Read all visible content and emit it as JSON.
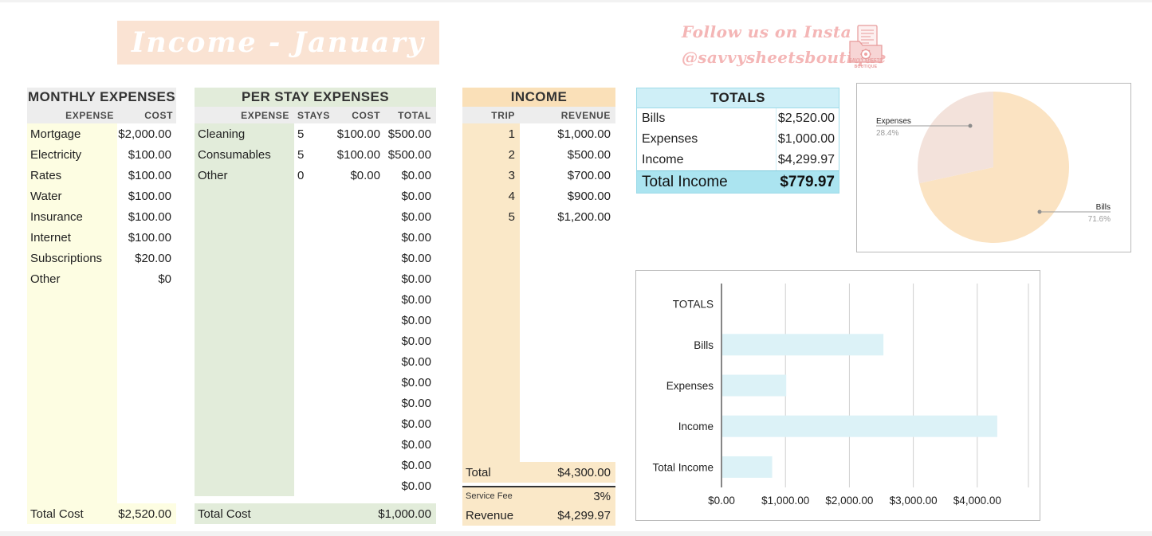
{
  "header": {
    "title": "Income - January",
    "insta_line1": "Follow us on Insta",
    "insta_line2": "@savvysheetsboutique",
    "logo_line1": "SAVVY SHEETS",
    "logo_line2": "BOUTIQUE"
  },
  "monthly_expenses": {
    "title": "MONTHLY EXPENSES",
    "columns": [
      "EXPENSE",
      "COST"
    ],
    "rows": [
      {
        "expense": "Mortgage",
        "cost": "$2,000.00"
      },
      {
        "expense": "Electricity",
        "cost": "$100.00"
      },
      {
        "expense": "Rates",
        "cost": "$100.00"
      },
      {
        "expense": "Water",
        "cost": "$100.00"
      },
      {
        "expense": "Insurance",
        "cost": "$100.00"
      },
      {
        "expense": "Internet",
        "cost": "$100.00"
      },
      {
        "expense": "Subscriptions",
        "cost": "$20.00"
      },
      {
        "expense": "Other",
        "cost": "$0"
      }
    ],
    "total_label": "Total Cost",
    "total_value": "$2,520.00"
  },
  "per_stay_expenses": {
    "title": "PER STAY EXPENSES",
    "columns": [
      "EXPENSE",
      "STAYS",
      "COST",
      "TOTAL"
    ],
    "rows": [
      {
        "expense": "Cleaning",
        "stays": "5",
        "cost": "$100.00",
        "total": "$500.00"
      },
      {
        "expense": "Consumables",
        "stays": "5",
        "cost": "$100.00",
        "total": "$500.00"
      },
      {
        "expense": "Other",
        "stays": "0",
        "cost": "$0.00",
        "total": "$0.00"
      },
      {
        "expense": "",
        "stays": "",
        "cost": "",
        "total": "$0.00"
      },
      {
        "expense": "",
        "stays": "",
        "cost": "",
        "total": "$0.00"
      },
      {
        "expense": "",
        "stays": "",
        "cost": "",
        "total": "$0.00"
      },
      {
        "expense": "",
        "stays": "",
        "cost": "",
        "total": "$0.00"
      },
      {
        "expense": "",
        "stays": "",
        "cost": "",
        "total": "$0.00"
      },
      {
        "expense": "",
        "stays": "",
        "cost": "",
        "total": "$0.00"
      },
      {
        "expense": "",
        "stays": "",
        "cost": "",
        "total": "$0.00"
      },
      {
        "expense": "",
        "stays": "",
        "cost": "",
        "total": "$0.00"
      },
      {
        "expense": "",
        "stays": "",
        "cost": "",
        "total": "$0.00"
      },
      {
        "expense": "",
        "stays": "",
        "cost": "",
        "total": "$0.00"
      },
      {
        "expense": "",
        "stays": "",
        "cost": "",
        "total": "$0.00"
      },
      {
        "expense": "",
        "stays": "",
        "cost": "",
        "total": "$0.00"
      },
      {
        "expense": "",
        "stays": "",
        "cost": "",
        "total": "$0.00"
      },
      {
        "expense": "",
        "stays": "",
        "cost": "",
        "total": "$0.00"
      },
      {
        "expense": "",
        "stays": "",
        "cost": "",
        "total": "$0.00"
      }
    ],
    "total_label": "Total Cost",
    "total_value": "$1,000.00"
  },
  "income": {
    "title": "INCOME",
    "columns": [
      "TRIP",
      "REVENUE"
    ],
    "rows": [
      {
        "trip": "1",
        "revenue": "$1,000.00"
      },
      {
        "trip": "2",
        "revenue": "$500.00"
      },
      {
        "trip": "3",
        "revenue": "$700.00"
      },
      {
        "trip": "4",
        "revenue": "$900.00"
      },
      {
        "trip": "5",
        "revenue": "$1,200.00"
      }
    ],
    "total_label": "Total",
    "total_value": "$4,300.00",
    "fee_label": "Service Fee",
    "fee_value": "3%",
    "revenue_label": "Revenue",
    "revenue_value": "$4,299.97"
  },
  "totals": {
    "title": "TOTALS",
    "rows": [
      {
        "label": "Bills",
        "value": "$2,520.00"
      },
      {
        "label": "Expenses",
        "value": "$1,000.00"
      },
      {
        "label": "Income",
        "value": "$4,299.97"
      }
    ],
    "final_label": "Total Income",
    "final_value": "$779.97"
  },
  "colors": {
    "cream": "#FDFDE2",
    "sage": "#E2ECDA",
    "peach": "#FAE8C8",
    "peach_header": "#FAE0B8",
    "blue": "#CFEFF7",
    "blue_strong": "#ABE4F0",
    "banner": "#FAE3D3",
    "pink": "#F4B6B6",
    "pie_bills": "#FBE3C2",
    "pie_expenses": "#F3E2DB",
    "bar_fill": "#DCF2F7"
  },
  "chart_data": [
    {
      "type": "pie",
      "title": "",
      "labels": [
        "Bills",
        "Expenses"
      ],
      "values": [
        71.6,
        28.4
      ],
      "value_labels": [
        "71.6%",
        "28.4%"
      ],
      "colors": [
        "#FBE3C2",
        "#F3E2DB"
      ],
      "legend": "callout-labels"
    },
    {
      "type": "bar",
      "orientation": "horizontal",
      "title": "",
      "categories": [
        "TOTALS",
        "Bills",
        "Expenses",
        "Income",
        "Total Income"
      ],
      "values": [
        0,
        2520.0,
        1000.0,
        4299.97,
        779.97
      ],
      "xlabel": "",
      "ylabel": "",
      "xlim": [
        0,
        4800
      ],
      "xticks": [
        0,
        1000,
        2000,
        3000,
        4000
      ],
      "xtick_labels": [
        "$0.00",
        "$1,000.00",
        "$2,000.00",
        "$3,000.00",
        "$4,000.00"
      ],
      "grid": true,
      "bar_color": "#DCF2F7"
    }
  ]
}
